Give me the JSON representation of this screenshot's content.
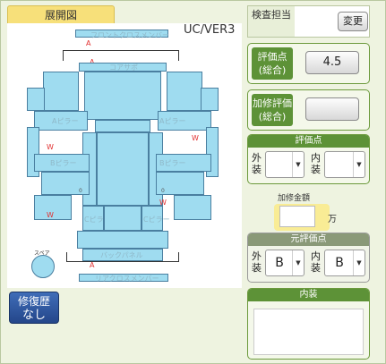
{
  "diagram": {
    "tab_title": "展開図",
    "model": "UC/VER3",
    "labels": {
      "front_cross": "フロントクロスメンバー",
      "core_support": "コアサポ",
      "a_pillar": "Aピラー",
      "b_pillar": "Bピラー",
      "c_pillar": "Cピラー",
      "back_panel": "バックパネル",
      "rear_cross": "リアクロスメンバー",
      "spare": "スペア"
    },
    "marks": {
      "a": "A",
      "w": "W",
      "zero": "0"
    }
  },
  "repair_history": {
    "line1": "修復歴",
    "line2": "なし"
  },
  "inspector": {
    "label": "検査担当",
    "button": "変更"
  },
  "overall_score": {
    "label": "評価点(総合)",
    "value": "4.5"
  },
  "repair_score": {
    "label": "加修評価(総合)",
    "value": ""
  },
  "score": {
    "title": "評価点",
    "exterior": "外装",
    "interior": "内装",
    "exterior_value": "",
    "interior_value": ""
  },
  "repair_amount": {
    "label": "加修金額",
    "unit": "万",
    "value": ""
  },
  "original_score": {
    "title": "元評価点",
    "exterior": "外装",
    "interior": "内装",
    "exterior_value": "B",
    "interior_value": "B"
  },
  "interior_notes": {
    "title": "内装",
    "value": ""
  }
}
